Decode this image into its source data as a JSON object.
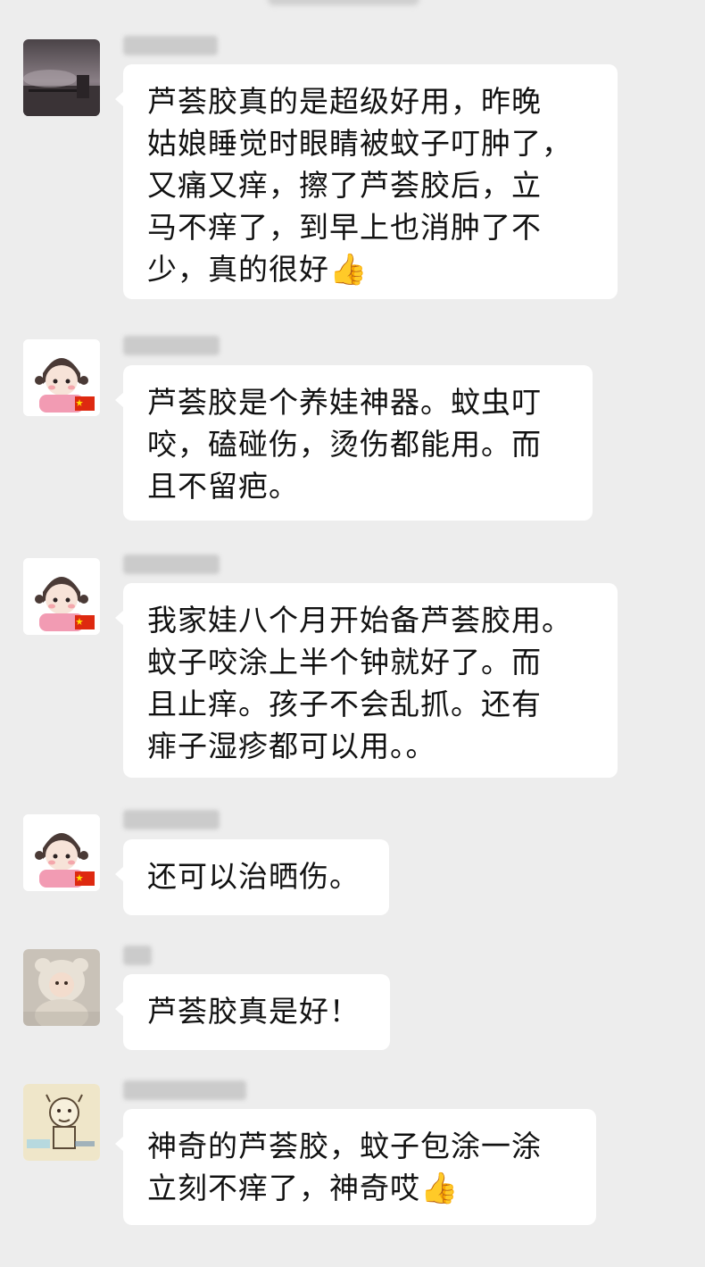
{
  "chat": {
    "messages": [
      {
        "lines": [
          "芦荟胶真的是超级好用，昨晚",
          "姑娘睡觉时眼睛被蚊子叮肿了，",
          "又痛又痒，擦了芦荟胶后，立",
          "马不痒了，到早上也消肿了不",
          "少，真的很好"
        ],
        "emoji": "👍"
      },
      {
        "lines": [
          "芦荟胶是个养娃神器。蚊虫叮",
          "咬，磕碰伤，烫伤都能用。而",
          "且不留疤。"
        ]
      },
      {
        "lines": [
          "我家娃八个月开始备芦荟胶用。",
          "蚊子咬涂上半个钟就好了。而",
          "且止痒。孩子不会乱抓。还有",
          "痱子湿疹都可以用。。"
        ]
      },
      {
        "lines": [
          "还可以治晒伤。"
        ]
      },
      {
        "lines": [
          "芦荟胶真是好！"
        ]
      },
      {
        "lines": [
          "神奇的芦荟胶，蚊子包涂一涂",
          "立刻不痒了，神奇哎"
        ],
        "emoji": "👍"
      }
    ]
  }
}
